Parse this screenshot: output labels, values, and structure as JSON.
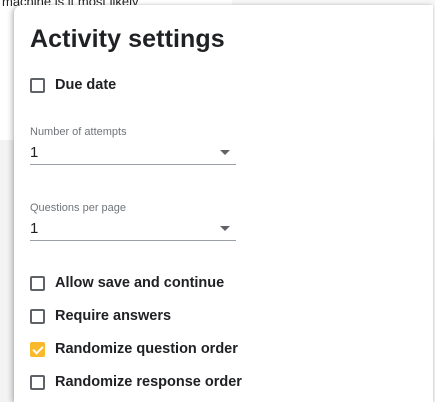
{
  "background": {
    "question_text": "machine is it most likely"
  },
  "panel": {
    "title": "Activity settings",
    "due_date_label": "Due date",
    "attempts": {
      "label": "Number of attempts",
      "value": "1"
    },
    "questions_per_page": {
      "label": "Questions per page",
      "value": "1"
    },
    "options": [
      {
        "label": "Allow save and continue",
        "checked": false
      },
      {
        "label": "Require answers",
        "checked": false
      },
      {
        "label": "Randomize question order",
        "checked": true
      },
      {
        "label": "Randomize response order",
        "checked": false
      }
    ]
  },
  "colors": {
    "checked_fill": "#f9b92b",
    "text": "#202124",
    "muted": "#70757a"
  },
  "icons": {
    "select_arrow": "caret-down-icon"
  }
}
